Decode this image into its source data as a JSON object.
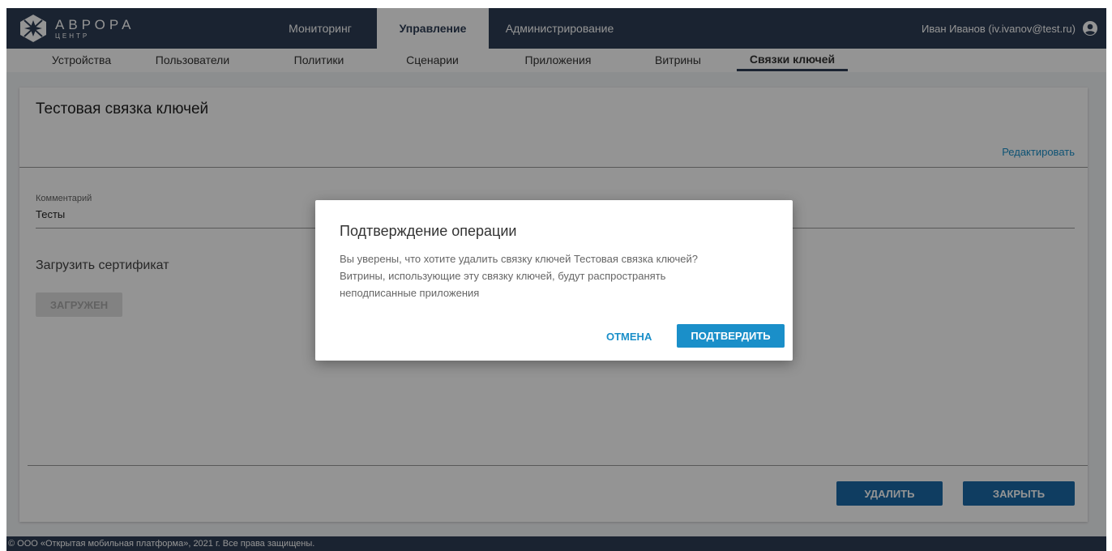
{
  "brand": {
    "name": "АВРОРА",
    "sub": "ЦЕНТР",
    "icon": "aurora-logo-icon"
  },
  "main_tabs": [
    {
      "label": "Мониторинг",
      "active": false
    },
    {
      "label": "Управление",
      "active": true
    },
    {
      "label": "Администрирование",
      "active": false
    }
  ],
  "user": {
    "name": "Иван Иванов (iv.ivanov@test.ru)",
    "icon": "account-circle-icon"
  },
  "sub_tabs": [
    {
      "label": "Устройства",
      "active": false
    },
    {
      "label": "Пользователи",
      "active": false
    },
    {
      "label": "Политики",
      "active": false
    },
    {
      "label": "Сценарии",
      "active": false
    },
    {
      "label": "Приложения",
      "active": false
    },
    {
      "label": "Витрины",
      "active": false
    },
    {
      "label": "Связки ключей",
      "active": true
    }
  ],
  "card": {
    "title": "Тестовая связка ключей",
    "edit_label": "Редактировать",
    "comment_label": "Комментарий",
    "comment_value": "Тесты",
    "upload_title": "Загрузить сертификат",
    "uploaded_label": "ЗАГРУЖЕН",
    "delete_label": "УДАЛИТЬ",
    "close_label": "ЗАКРЫТЬ"
  },
  "dialog": {
    "title": "Подтверждение операции",
    "lines": [
      "Вы уверены, что хотите удалить связку ключей Тестовая связка ключей?",
      "Витрины, использующие эту связку ключей, будут распространять",
      "неподписанные приложения"
    ],
    "cancel_label": "ОТМЕНА",
    "confirm_label": "ПОДТВЕРДИТЬ"
  },
  "footer": {
    "text": "© ООО «Открытая мобильная платформа», 2021 г. Все права защищены."
  },
  "colors": {
    "header": "#2e3d55",
    "accent": "#1a8fc9",
    "dark_button": "#1a6aa8"
  }
}
